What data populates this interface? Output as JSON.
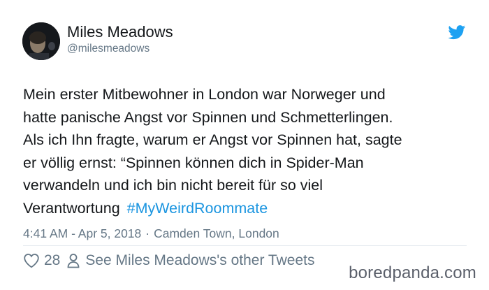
{
  "author": {
    "display_name": "Miles Meadows",
    "handle": "@milesmeadows"
  },
  "icons": {
    "brand": "twitter-bird-icon",
    "like": "heart-icon",
    "profile": "person-icon"
  },
  "tweet": {
    "lines": [
      "Mein erster Mitbewohner in London war Norweger und",
      "hatte panische Angst vor Spinnen und Schmetterlingen.",
      "Als ich Ihn fragte, warum er Angst vor Spinnen hat, sagte",
      "er völlig ernst: “Spinnen können dich in Spider-Man",
      "verwandeln und ich bin nicht bereit für so viel",
      "Verantwortung"
    ],
    "hashtag": "#MyWeirdRoommate"
  },
  "meta": {
    "timestamp": "4:41 AM - Apr 5, 2018",
    "separator": "·",
    "location": "Camden Town, London"
  },
  "actions": {
    "like_count": "28",
    "other_tweets_link": "See Miles Meadows's other Tweets"
  },
  "watermark": "boredpanda.com",
  "colors": {
    "text": "#14171a",
    "secondary": "#657786",
    "link": "#1b95e0",
    "brand": "#1da1f2"
  }
}
